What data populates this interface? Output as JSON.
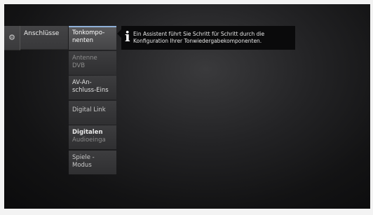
{
  "settings_icon": "gear-icon",
  "category": {
    "label": "Anschlüsse"
  },
  "submenu": {
    "items": [
      {
        "line1": "Tonkompo-",
        "line2": "nenten"
      },
      {
        "line1": "Antenne",
        "line2": "DVB"
      },
      {
        "line1": "AV-An-",
        "line2": "schluss-Eins"
      },
      {
        "line1": "Digital Link",
        "line2": ""
      },
      {
        "line1": "Digitalen",
        "line2": "Audioeinga"
      },
      {
        "line1": "Spiele -",
        "line2": "Modus"
      }
    ]
  },
  "info": {
    "icon": "info-icon",
    "glyph": "i",
    "line1": "Ein Assistent führt Sie Schritt für Schritt durch die",
    "line2": "Konfiguration Ihrer Tonwiedergabekomponenten."
  }
}
